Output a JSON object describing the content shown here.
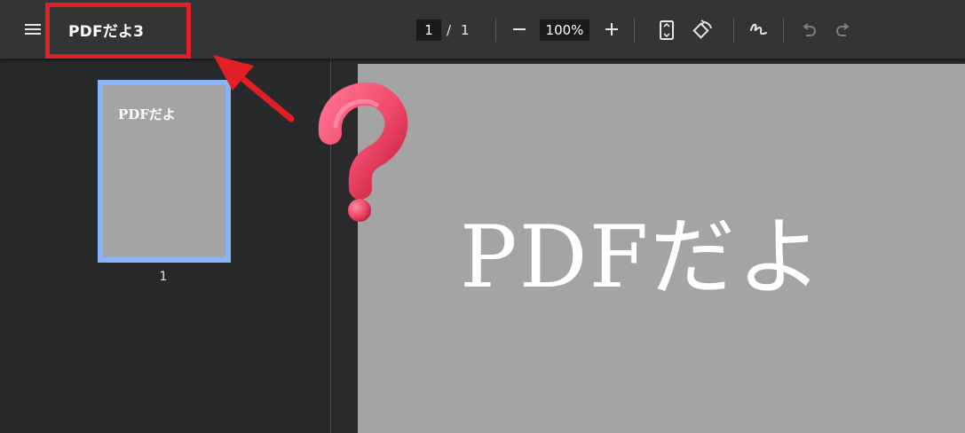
{
  "toolbar": {
    "title": "PDFだよ3",
    "current_page": "1",
    "page_separator": "/",
    "total_pages": "1",
    "zoom": "100%"
  },
  "sidebar": {
    "thumbnail_text": "PDFだよ",
    "thumbnail_number": "1"
  },
  "page": {
    "content_text": "PDFだよ"
  },
  "icons": [
    "menu-icon",
    "zoom-out-icon",
    "zoom-in-icon",
    "fit-page-icon",
    "rotate-icon",
    "draw-icon",
    "undo-icon",
    "redo-icon"
  ],
  "colors": {
    "toolbar_bg": "#333436",
    "sidebar_bg": "#28292b",
    "page_bg": "#a4a4a4",
    "thumb_border": "#8ab4f8",
    "annotation_red": "#e11f24",
    "question_mark": "#f0486a"
  }
}
